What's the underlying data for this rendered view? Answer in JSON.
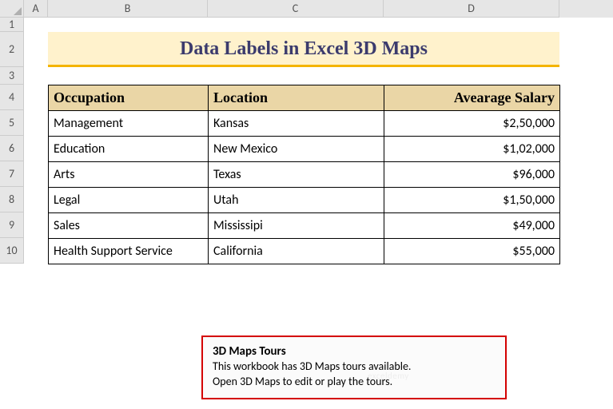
{
  "columns": [
    "A",
    "B",
    "C",
    "D"
  ],
  "rows": [
    "1",
    "2",
    "3",
    "4",
    "5",
    "6",
    "7",
    "8",
    "9",
    "10"
  ],
  "title": "Data Labels in Excel 3D Maps",
  "table": {
    "headers": {
      "occupation": "Occupation",
      "location": "Location",
      "salary": "Avearage Salary"
    },
    "rows": [
      {
        "occupation": "Management",
        "location": "Kansas",
        "salary": "$2,50,000"
      },
      {
        "occupation": "Education",
        "location": "New Mexico",
        "salary": "$1,02,000"
      },
      {
        "occupation": "Arts",
        "location": "Texas",
        "salary": "$96,000"
      },
      {
        "occupation": "Legal",
        "location": "Utah",
        "salary": "$1,50,000"
      },
      {
        "occupation": "Sales",
        "location": "Mississipi",
        "salary": "$49,000"
      },
      {
        "occupation": "Health Support Service",
        "location": "California",
        "salary": "$55,000"
      }
    ]
  },
  "callout": {
    "title": "3D Maps Tours",
    "line1": "This workbook has 3D Maps tours available.",
    "line2": "Open 3D Maps to edit or play the tours."
  },
  "watermark": "exceldemy"
}
